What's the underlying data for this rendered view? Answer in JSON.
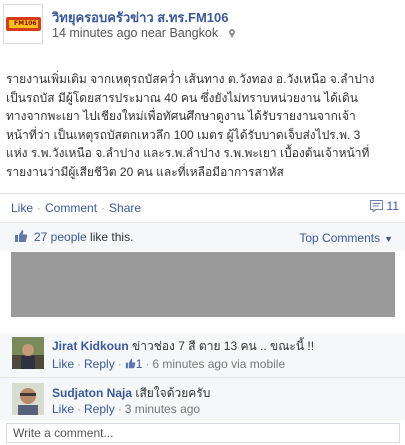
{
  "post": {
    "page_name": "วิทยุครอบครัวข่าว ส.ทร.FM106",
    "avatar_text": "FM106",
    "timestamp": "14 minutes ago near Bangkok",
    "body_lines": [
      "รายงานเพิ่มเติม จากเหตุรถบัสคว่ำ เส้นทาง ต.วังทอง อ.วังเหนือ จ.ลำปาง",
      "เป็นรถบัส มีผู้โดยสารประมาณ 40 คน ซึ่งยังไม่ทราบหน่วยงาน ได้เดิน",
      "ทางจากพะเยา ไปเชียงใหม่เพื่อทัศนศึกษาดูงาน ได้รับรายงานจากเจ้า",
      "หน้าที่ว่า เป็นเหตุรถบัสตกเหวลึก 100 เมตร ผู้ได้รับบาดเจ็บส่งไปร.พ. 3",
      "แห่ง ร.พ.วังเหนือ จ.ลำปาง และร.พ.ลำปาง ร.พ.พะเยา เบื้องต้นเจ้าหน้าที่",
      "รายงานว่ามีผู้เสียชีวิต 20 คน และที่เหลือมีอาการสาหัส"
    ]
  },
  "actions": {
    "like": "Like",
    "comment": "Comment",
    "share": "Share",
    "sep": "·",
    "comment_count": "11"
  },
  "likes": {
    "count_text": "27 people",
    "suffix": " like this.",
    "sort_label": "Top Comments",
    "sort_caret": "▼"
  },
  "comments": [
    {
      "name": "Jirat Kidkoun",
      "text": " ข่าวช่อง 7 สี ตาย 13 คน .. ขณะนี้ !!",
      "like": "Like",
      "reply": "Reply",
      "sep": "·",
      "likes_count": "1",
      "time": "6 minutes ago via mobile"
    },
    {
      "name": "Sudjaton Naja",
      "text": " เสียใจด้วยครับ",
      "like": "Like",
      "reply": "Reply",
      "sep": "·",
      "time": "3 minutes ago"
    }
  ],
  "composer": {
    "placeholder": "Write a comment..."
  }
}
